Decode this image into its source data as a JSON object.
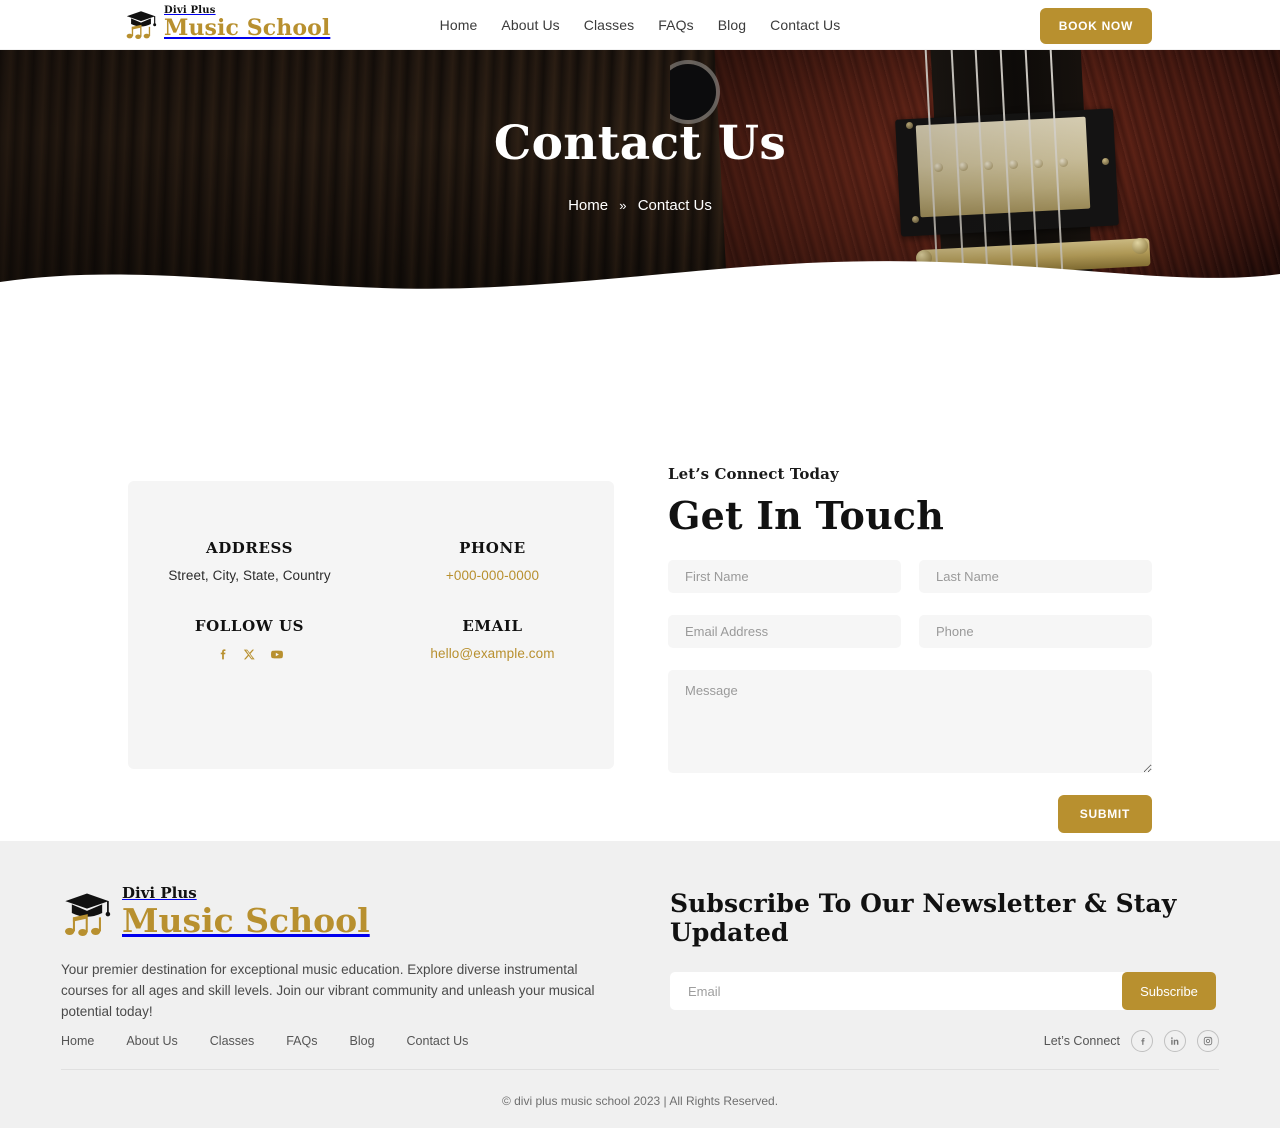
{
  "header": {
    "logo": {
      "sub": "Divi Plus",
      "main": "Music School",
      "icon": "graduation-cap-music-note-logo"
    },
    "nav": [
      {
        "label": "Home"
      },
      {
        "label": "About Us"
      },
      {
        "label": "Classes"
      },
      {
        "label": "FAQs"
      },
      {
        "label": "Blog"
      },
      {
        "label": "Contact Us"
      }
    ],
    "cta": {
      "label": "BOOK NOW"
    }
  },
  "hero": {
    "title": "Contact Us",
    "breadcrumb": {
      "home": "Home",
      "separator": "»",
      "current": "Contact Us"
    },
    "background_description": "close-up electric guitar body with humbucker pickup on dark wood"
  },
  "contact_card": {
    "address": {
      "title": "ADDRESS",
      "value": "Street, City, State, Country"
    },
    "phone": {
      "title": "PHONE",
      "value": "+000-000-0000"
    },
    "follow": {
      "title": "FOLLOW US",
      "socials": [
        {
          "name": "facebook-icon"
        },
        {
          "name": "x-twitter-icon"
        },
        {
          "name": "youtube-icon"
        }
      ]
    },
    "email": {
      "title": "EMAIL",
      "value": "hello@example.com"
    }
  },
  "form": {
    "eyebrow": "Let’s Connect Today",
    "title": "Get In Touch",
    "fields": {
      "first_name": {
        "placeholder": "First Name",
        "value": ""
      },
      "last_name": {
        "placeholder": "Last Name",
        "value": ""
      },
      "email": {
        "placeholder": "Email Address",
        "value": ""
      },
      "phone": {
        "placeholder": "Phone",
        "value": ""
      },
      "message": {
        "placeholder": "Message",
        "value": ""
      }
    },
    "submit": {
      "label": "SUBMIT"
    }
  },
  "footer": {
    "logo": {
      "sub": "Divi Plus",
      "main": "Music School"
    },
    "description": "Your premier destination for exceptional music education. Explore diverse instrumental courses for all ages and skill levels. Join our vibrant community and unleash your musical potential today!",
    "newsletter": {
      "title": "Subscribe To Our Newsletter & Stay Updated",
      "input": {
        "placeholder": "Email",
        "value": ""
      },
      "button": {
        "label": "Subscribe"
      }
    },
    "nav": [
      {
        "label": "Home"
      },
      {
        "label": "About Us"
      },
      {
        "label": "Classes"
      },
      {
        "label": "FAQs"
      },
      {
        "label": "Blog"
      },
      {
        "label": "Contact Us"
      }
    ],
    "connect": {
      "label": "Let’s Connect",
      "socials": [
        {
          "name": "facebook-icon"
        },
        {
          "name": "linkedin-icon"
        },
        {
          "name": "instagram-icon"
        }
      ]
    },
    "copyright": "© divi plus music school 2023 | All Rights Reserved."
  },
  "colors": {
    "accent_gold": "#b8902f",
    "card_bg": "#f5f5f5",
    "footer_bg": "#f0f0f0",
    "field_bg": "#f6f6f6",
    "text_dark": "#111111"
  }
}
